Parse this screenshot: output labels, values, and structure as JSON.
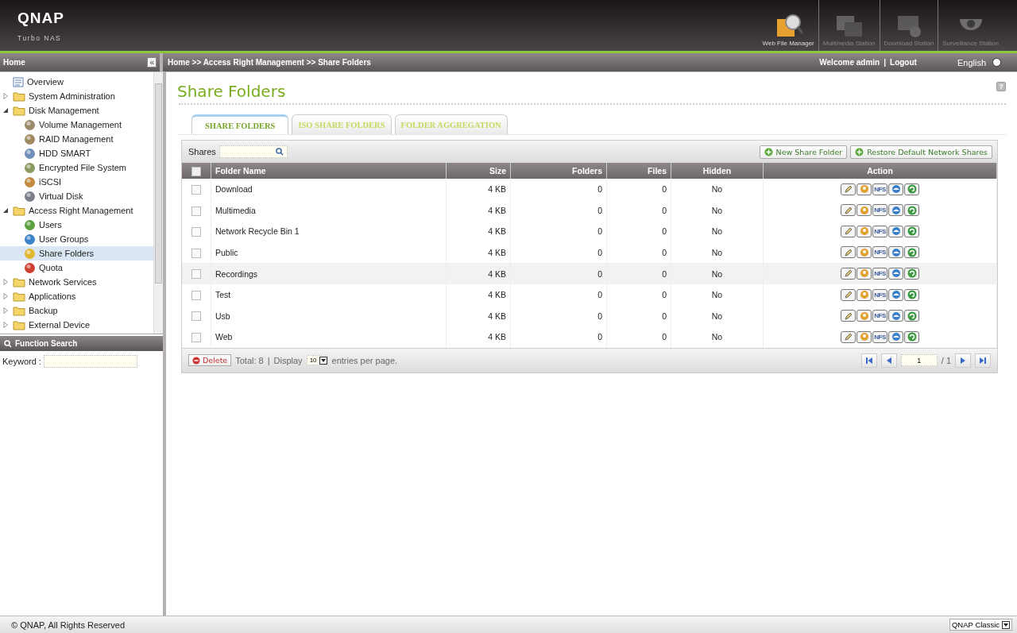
{
  "brand": {
    "logo": "QNAP",
    "subtitle": "Turbo NAS"
  },
  "stations": [
    {
      "label": "Web File Manager",
      "kind": "files",
      "active": true
    },
    {
      "label": "Multimedia Station",
      "kind": "media",
      "active": false
    },
    {
      "label": "Download Station",
      "kind": "download",
      "active": false
    },
    {
      "label": "Surveillance Station",
      "kind": "camera",
      "active": false
    }
  ],
  "sidebar": {
    "title": "Home",
    "collapse": "«",
    "items": [
      {
        "label": "Overview",
        "kind": "overview",
        "selected": false
      },
      {
        "label": "System Administration",
        "kind": "folder",
        "expanded": false,
        "selected": false
      },
      {
        "label": "Disk Management",
        "kind": "folder",
        "expanded": true,
        "selected": false,
        "children": [
          {
            "label": "Volume Management",
            "kind": "volume",
            "selected": false
          },
          {
            "label": "RAID Management",
            "kind": "raid",
            "selected": false
          },
          {
            "label": "HDD SMART",
            "kind": "hdd",
            "selected": false
          },
          {
            "label": "Encrypted File System",
            "kind": "lock",
            "selected": false
          },
          {
            "label": "iSCSI",
            "kind": "iscsi",
            "selected": false
          },
          {
            "label": "Virtual Disk",
            "kind": "disk",
            "selected": false
          }
        ]
      },
      {
        "label": "Access Right Management",
        "kind": "folder",
        "expanded": true,
        "selected": false,
        "children": [
          {
            "label": "Users",
            "kind": "user",
            "selected": false
          },
          {
            "label": "User Groups",
            "kind": "group",
            "selected": false
          },
          {
            "label": "Share Folders",
            "kind": "share",
            "selected": true
          },
          {
            "label": "Quota",
            "kind": "quota",
            "selected": false
          }
        ]
      },
      {
        "label": "Network Services",
        "kind": "folder",
        "expanded": false,
        "selected": false
      },
      {
        "label": "Applications",
        "kind": "folder",
        "expanded": false,
        "selected": false
      },
      {
        "label": "Backup",
        "kind": "folder",
        "expanded": false,
        "selected": false
      },
      {
        "label": "External Device",
        "kind": "folder",
        "expanded": false,
        "selected": false
      }
    ]
  },
  "function_search": {
    "title": "Function Search",
    "keyword_label": "Keyword :"
  },
  "breadcrumb": "Home >> Access Right Management >> Share Folders",
  "user_bar": {
    "welcome": "Welcome admin",
    "separator": "|",
    "logout": "Logout",
    "language": "English"
  },
  "page_title": "Share Folders",
  "help": "?",
  "tabs": [
    {
      "label": "SHARE FOLDERS",
      "selected": true
    },
    {
      "label": "ISO SHARE FOLDERS",
      "selected": false
    },
    {
      "label": "FOLDER AGGREGATION",
      "selected": false
    }
  ],
  "toolbar": {
    "search_label": "Shares",
    "buttons": [
      "New Share Folder",
      "Restore Default Network Shares"
    ]
  },
  "table": {
    "all_checked": false,
    "columns": [
      "Folder Name",
      "Size",
      "Folders",
      "Files",
      "Hidden",
      "Action"
    ],
    "rows": [
      {
        "checked": false,
        "name": "Download",
        "size": "4 KB",
        "folders": "0",
        "files": "0",
        "hidden": "No",
        "actions": [
          {
            "kind": "edit"
          },
          {
            "kind": "permission"
          },
          {
            "kind": "nfs",
            "label": "NFS"
          },
          {
            "kind": "network"
          },
          {
            "kind": "refresh"
          }
        ]
      },
      {
        "checked": false,
        "name": "Multimedia",
        "size": "4 KB",
        "folders": "0",
        "files": "0",
        "hidden": "No",
        "actions": [
          {
            "kind": "edit"
          },
          {
            "kind": "permission"
          },
          {
            "kind": "nfs",
            "label": "NFS"
          },
          {
            "kind": "network"
          },
          {
            "kind": "refresh"
          }
        ]
      },
      {
        "checked": false,
        "name": "Network Recycle Bin 1",
        "size": "4 KB",
        "folders": "0",
        "files": "0",
        "hidden": "No",
        "actions": [
          {
            "kind": "edit"
          },
          {
            "kind": "permission"
          },
          {
            "kind": "nfs",
            "label": "NFS"
          },
          {
            "kind": "network"
          },
          {
            "kind": "refresh"
          }
        ]
      },
      {
        "checked": false,
        "name": "Public",
        "size": "4 KB",
        "folders": "0",
        "files": "0",
        "hidden": "No",
        "actions": [
          {
            "kind": "edit"
          },
          {
            "kind": "permission"
          },
          {
            "kind": "nfs",
            "label": "NFS"
          },
          {
            "kind": "network"
          },
          {
            "kind": "refresh"
          }
        ]
      },
      {
        "checked": false,
        "name": "Recordings",
        "size": "4 KB",
        "folders": "0",
        "files": "0",
        "hidden": "No",
        "actions": [
          {
            "kind": "edit"
          },
          {
            "kind": "permission"
          },
          {
            "kind": "nfs",
            "label": "NFS"
          },
          {
            "kind": "network"
          },
          {
            "kind": "refresh"
          }
        ]
      },
      {
        "checked": false,
        "name": "Test",
        "size": "4 KB",
        "folders": "0",
        "files": "0",
        "hidden": "No",
        "actions": [
          {
            "kind": "edit"
          },
          {
            "kind": "permission"
          },
          {
            "kind": "nfs",
            "label": "NFS"
          },
          {
            "kind": "network"
          },
          {
            "kind": "refresh"
          }
        ]
      },
      {
        "checked": false,
        "name": "Usb",
        "size": "4 KB",
        "folders": "0",
        "files": "0",
        "hidden": "No",
        "actions": [
          {
            "kind": "edit"
          },
          {
            "kind": "permission"
          },
          {
            "kind": "nfs",
            "label": "NFS"
          },
          {
            "kind": "network"
          },
          {
            "kind": "refresh"
          }
        ]
      },
      {
        "checked": false,
        "name": "Web",
        "size": "4 KB",
        "folders": "0",
        "files": "0",
        "hidden": "No",
        "actions": [
          {
            "kind": "edit"
          },
          {
            "kind": "permission"
          },
          {
            "kind": "nfs",
            "label": "NFS"
          },
          {
            "kind": "network"
          },
          {
            "kind": "refresh"
          }
        ]
      }
    ]
  },
  "pager": {
    "delete": "Delete",
    "total": "Total: 8",
    "separator": "|",
    "display": "Display",
    "per_page": "10",
    "entries": "entries per page.",
    "page": "1",
    "of": "/ 1"
  },
  "footer": {
    "copyright": "© QNAP, All Rights Reserved",
    "theme": "QNAP Classic"
  }
}
